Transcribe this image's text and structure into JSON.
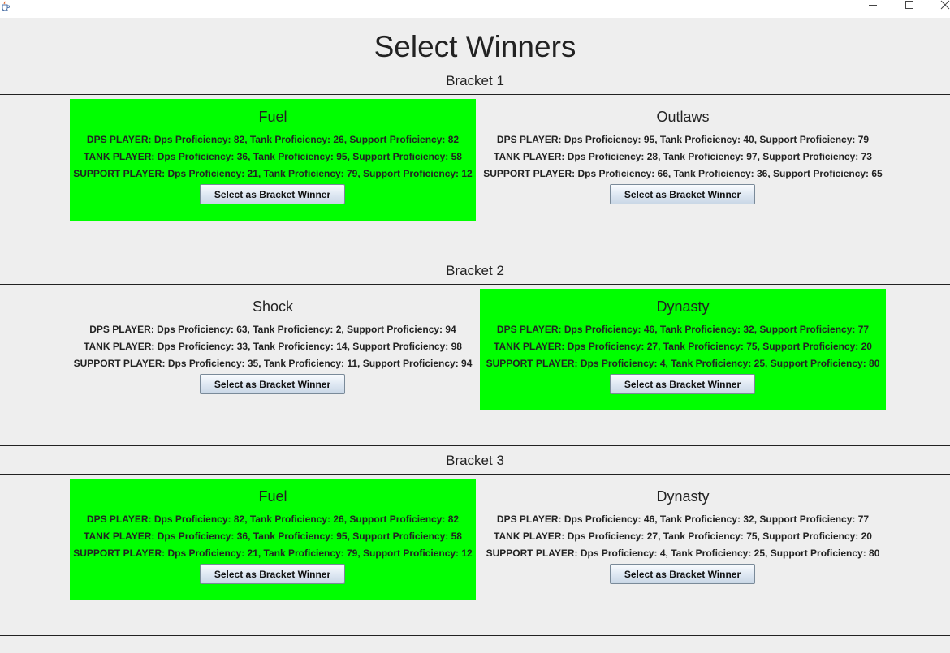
{
  "window": {
    "icon": "java-cup-icon",
    "controls": [
      "minimize-icon",
      "maximize-icon",
      "close-icon"
    ]
  },
  "page_title": "Select Winners",
  "colors": {
    "background": "#eeeeee",
    "winner_highlight": "#00ff00",
    "text": "#222222"
  },
  "brackets": [
    {
      "label": "Bracket 1",
      "teams": [
        {
          "name": "Fuel",
          "selected": true,
          "players": [
            "DPS PLAYER: Dps Proficiency: 82, Tank Proficiency: 26, Support Proficiency: 82",
            "TANK PLAYER: Dps Proficiency: 36, Tank Proficiency: 95, Support Proficiency: 58",
            "SUPPORT PLAYER: Dps Proficiency: 21, Tank Proficiency: 79, Support Proficiency: 12"
          ],
          "button_label": "Select as Bracket Winner"
        },
        {
          "name": "Outlaws",
          "selected": false,
          "players": [
            "DPS PLAYER: Dps Proficiency: 95, Tank Proficiency: 40, Support Proficiency: 79",
            "TANK PLAYER: Dps Proficiency: 28, Tank Proficiency: 97, Support Proficiency: 73",
            "SUPPORT PLAYER: Dps Proficiency: 66, Tank Proficiency: 36, Support Proficiency: 65"
          ],
          "button_label": "Select as Bracket Winner"
        }
      ]
    },
    {
      "label": "Bracket 2",
      "teams": [
        {
          "name": "Shock",
          "selected": false,
          "players": [
            "DPS PLAYER: Dps Proficiency: 63, Tank Proficiency: 2, Support Proficiency: 94",
            "TANK PLAYER: Dps Proficiency: 33, Tank Proficiency: 14, Support Proficiency: 98",
            "SUPPORT PLAYER: Dps Proficiency: 35, Tank Proficiency: 11, Support Proficiency: 94"
          ],
          "button_label": "Select as Bracket Winner"
        },
        {
          "name": "Dynasty",
          "selected": true,
          "players": [
            "DPS PLAYER: Dps Proficiency: 46, Tank Proficiency: 32, Support Proficiency: 77",
            "TANK PLAYER: Dps Proficiency: 27, Tank Proficiency: 75, Support Proficiency: 20",
            "SUPPORT PLAYER: Dps Proficiency: 4, Tank Proficiency: 25, Support Proficiency: 80"
          ],
          "button_label": "Select as Bracket Winner"
        }
      ]
    },
    {
      "label": "Bracket 3",
      "teams": [
        {
          "name": "Fuel",
          "selected": true,
          "players": [
            "DPS PLAYER: Dps Proficiency: 82, Tank Proficiency: 26, Support Proficiency: 82",
            "TANK PLAYER: Dps Proficiency: 36, Tank Proficiency: 95, Support Proficiency: 58",
            "SUPPORT PLAYER: Dps Proficiency: 21, Tank Proficiency: 79, Support Proficiency: 12"
          ],
          "button_label": "Select as Bracket Winner"
        },
        {
          "name": "Dynasty",
          "selected": false,
          "players": [
            "DPS PLAYER: Dps Proficiency: 46, Tank Proficiency: 32, Support Proficiency: 77",
            "TANK PLAYER: Dps Proficiency: 27, Tank Proficiency: 75, Support Proficiency: 20",
            "SUPPORT PLAYER: Dps Proficiency: 4, Tank Proficiency: 25, Support Proficiency: 80"
          ],
          "button_label": "Select as Bracket Winner"
        }
      ]
    }
  ]
}
